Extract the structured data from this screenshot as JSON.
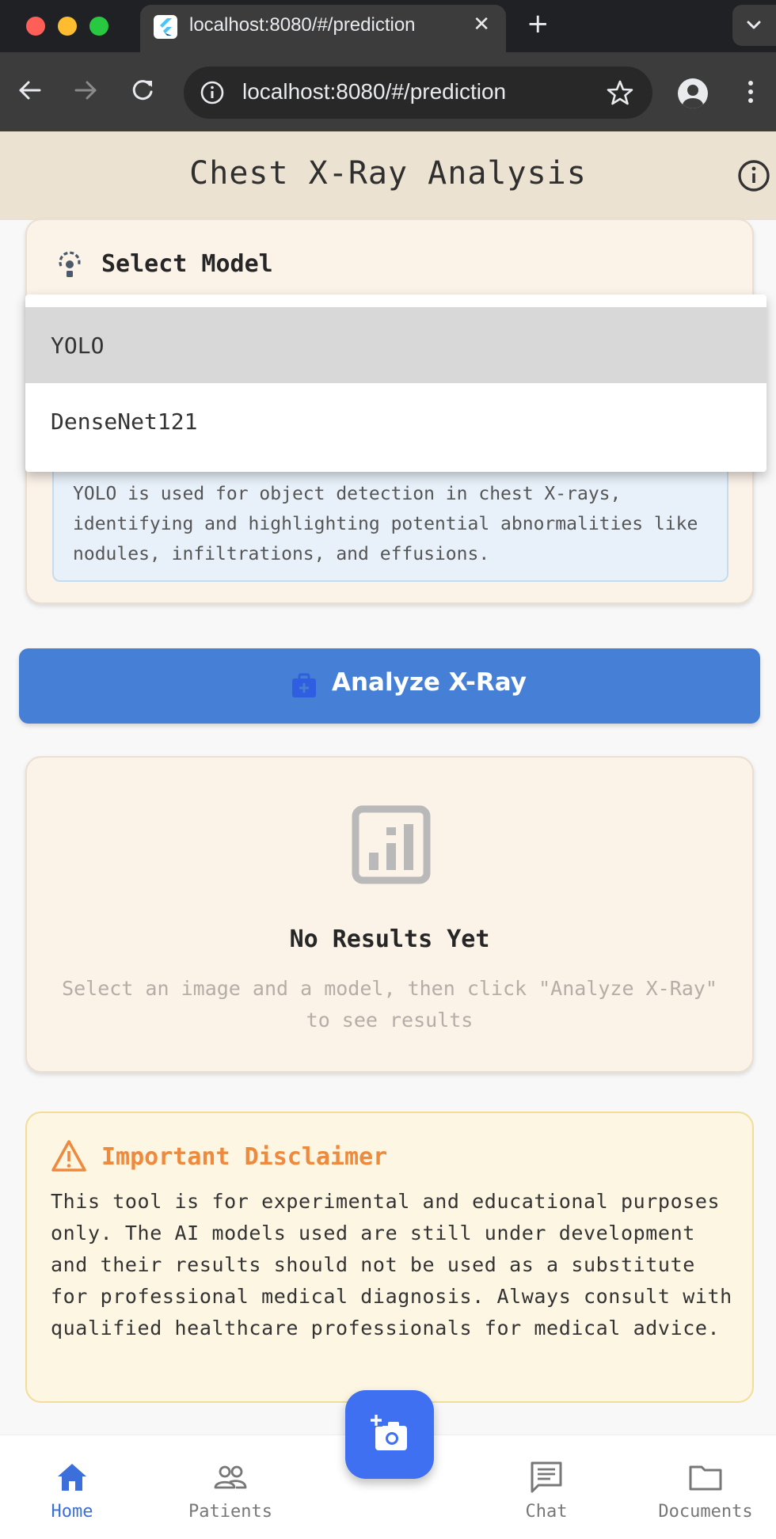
{
  "browser": {
    "tab_title": "localhost:8080/#/prediction",
    "url": "localhost:8080/#/prediction",
    "close_glyph": "✕",
    "new_tab_glyph": "+"
  },
  "app": {
    "title": "Chest X-Ray Analysis"
  },
  "model_card": {
    "header": "Select Model",
    "options": [
      "YOLO",
      "DenseNet121"
    ],
    "selected": "YOLO",
    "description": "YOLO is used for object detection in chest X-rays, identifying and highlighting potential abnormalities like nodules, infiltrations, and effusions."
  },
  "analyze_button": {
    "label": "Analyze X-Ray"
  },
  "results": {
    "title": "No Results Yet",
    "hint": "Select an image and a model, then click \"Analyze X-Ray\" to see results"
  },
  "disclaimer": {
    "title": "Important Disclaimer",
    "body": "This tool is for experimental and educational purposes only. The AI models used are still under development and their results should not be used as a substitute for professional medical diagnosis. Always consult with qualified healthcare professionals for medical advice."
  },
  "bottom_nav": {
    "items": [
      {
        "label": "Home",
        "icon": "home-icon",
        "active": true
      },
      {
        "label": "Patients",
        "icon": "people-icon",
        "active": false
      },
      {
        "label": "Chat",
        "icon": "chat-icon",
        "active": false
      },
      {
        "label": "Documents",
        "icon": "folder-icon",
        "active": false
      }
    ],
    "fab_icon": "add-photo-icon"
  },
  "colors": {
    "primary": "#467fd6",
    "fab": "#3f70f1",
    "card_bg": "#fbf2e8",
    "appbar_bg": "#ece2d2",
    "warning": "#ee8a3e",
    "nav_active": "#3b6fd9"
  }
}
